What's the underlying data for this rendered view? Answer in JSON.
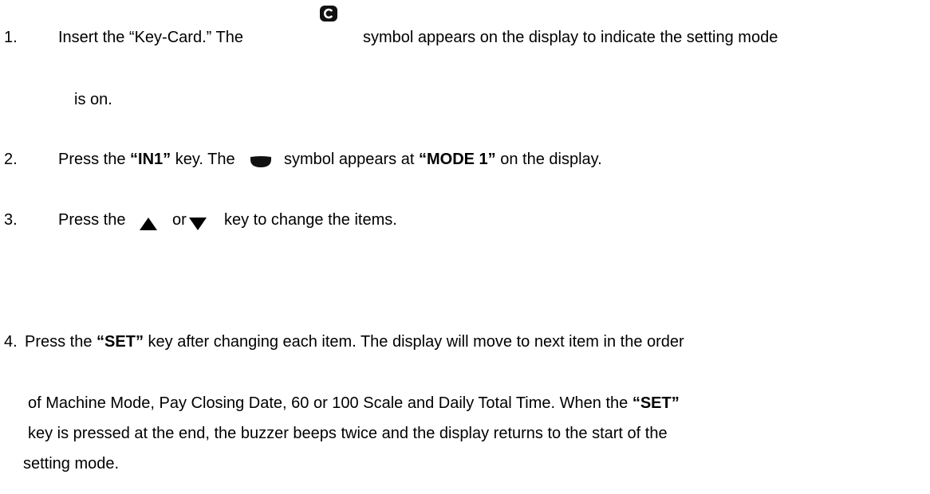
{
  "steps": [
    {
      "number": "1.",
      "text_a": "Insert the “Key-Card.”  The",
      "text_b": "symbol appears on the display to indicate the setting mode",
      "text_c": "is on.",
      "icon": "key-card-c-icon"
    },
    {
      "number": "2.",
      "text_a": "Press the ",
      "key": "“IN1”",
      "text_b": " key. The",
      "text_c": "symbol appears at ",
      "mode": "“MODE 1”",
      "text_d": " on the display.",
      "icon": "mode-indicator-icon"
    },
    {
      "number": "3.",
      "text_a": "Press the",
      "text_or": "or",
      "text_b": "key to change the items.",
      "icons": [
        "up-triangle-icon",
        "down-triangle-icon"
      ]
    },
    {
      "number": "4.",
      "text_a": "Press the ",
      "key": "“SET”",
      "text_b": " key after changing each item.  The display will move to next item in the order",
      "line2_a": "of Machine Mode, Pay Closing Date, 60 or 100 Scale and Daily Total Time.  When the ",
      "line2_key": "“SET”",
      "line3": "key is pressed at the end, the buzzer beeps twice and the display returns to the start of the",
      "line4": "setting mode."
    }
  ]
}
